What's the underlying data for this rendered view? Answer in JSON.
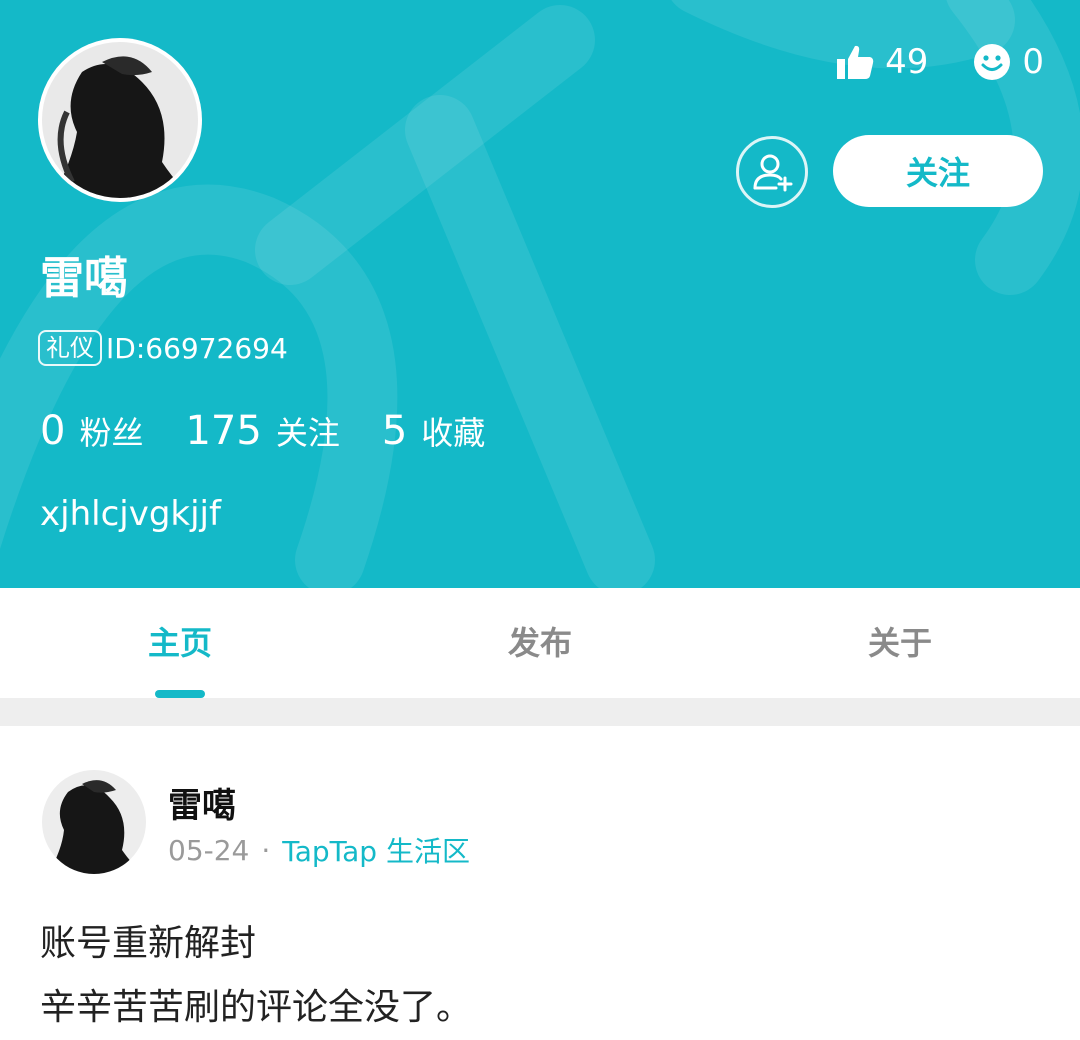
{
  "profile": {
    "name": "雷噶",
    "badge": "礼仪",
    "id_text": "ID:66972694",
    "bio": "xjhlcjvgkjjf",
    "likes": "49",
    "smiles": "0",
    "follow_label": "关注",
    "counts": [
      {
        "num": "0",
        "label": "粉丝"
      },
      {
        "num": "175",
        "label": "关注"
      },
      {
        "num": "5",
        "label": "收藏"
      }
    ]
  },
  "tabs": [
    {
      "label": "主页",
      "active": true
    },
    {
      "label": "发布",
      "active": false
    },
    {
      "label": "关于",
      "active": false
    }
  ],
  "post": {
    "author": "雷噶",
    "date": "05-24",
    "dot": "·",
    "forum": "TapTap 生活区",
    "lines": [
      "账号重新解封",
      "辛辛苦苦刷的评论全没了。"
    ]
  },
  "colors": {
    "accent": "#14b9c8",
    "divider": "#eeeeee"
  },
  "icons": {
    "likes": "thumbs-up-icon",
    "smiles": "smiley-icon",
    "add_friend": "add-friend-icon"
  }
}
